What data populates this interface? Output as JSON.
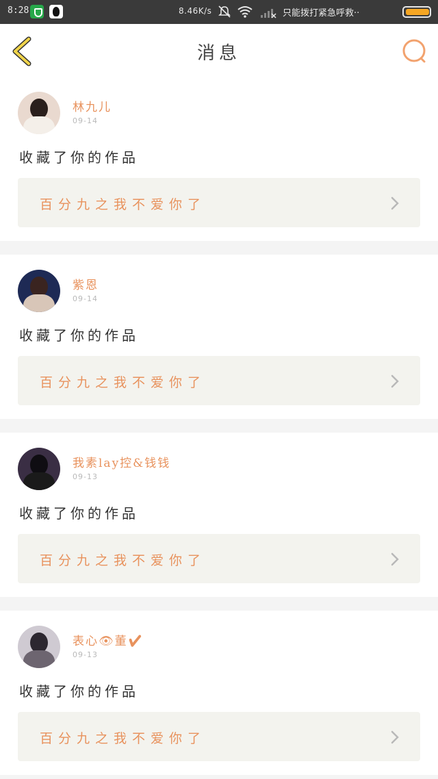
{
  "status_bar": {
    "time": "8:28",
    "speed": "8.46K/s",
    "carrier_text": "只能拨打紧急呼救··"
  },
  "header": {
    "title": "消息"
  },
  "messages": [
    {
      "user": "林九儿",
      "date": "09-14",
      "action": "收藏了你的作品",
      "work_title": "百分九之我不爱你了"
    },
    {
      "user": "紫恩",
      "date": "09-14",
      "action": "收藏了你的作品",
      "work_title": "百分九之我不爱你了"
    },
    {
      "user": "我素lay控&钱钱",
      "date": "09-13",
      "action": "收藏了你的作品",
      "work_title": "百分九之我不爱你了"
    },
    {
      "user": "表心👁董✔",
      "date": "09-13",
      "action": "收藏了你的作品",
      "work_title": "百分九之我不爱你了"
    }
  ],
  "colors": {
    "accent": "#e8925d",
    "back_icon": "#f0d44a",
    "card_inner_bg": "#f3f3ee",
    "status_bar_bg": "#3a3a3a"
  },
  "icons": {
    "back": "chevron-left-icon",
    "search": "search-icon",
    "card_arrow": "chevron-right-icon"
  }
}
